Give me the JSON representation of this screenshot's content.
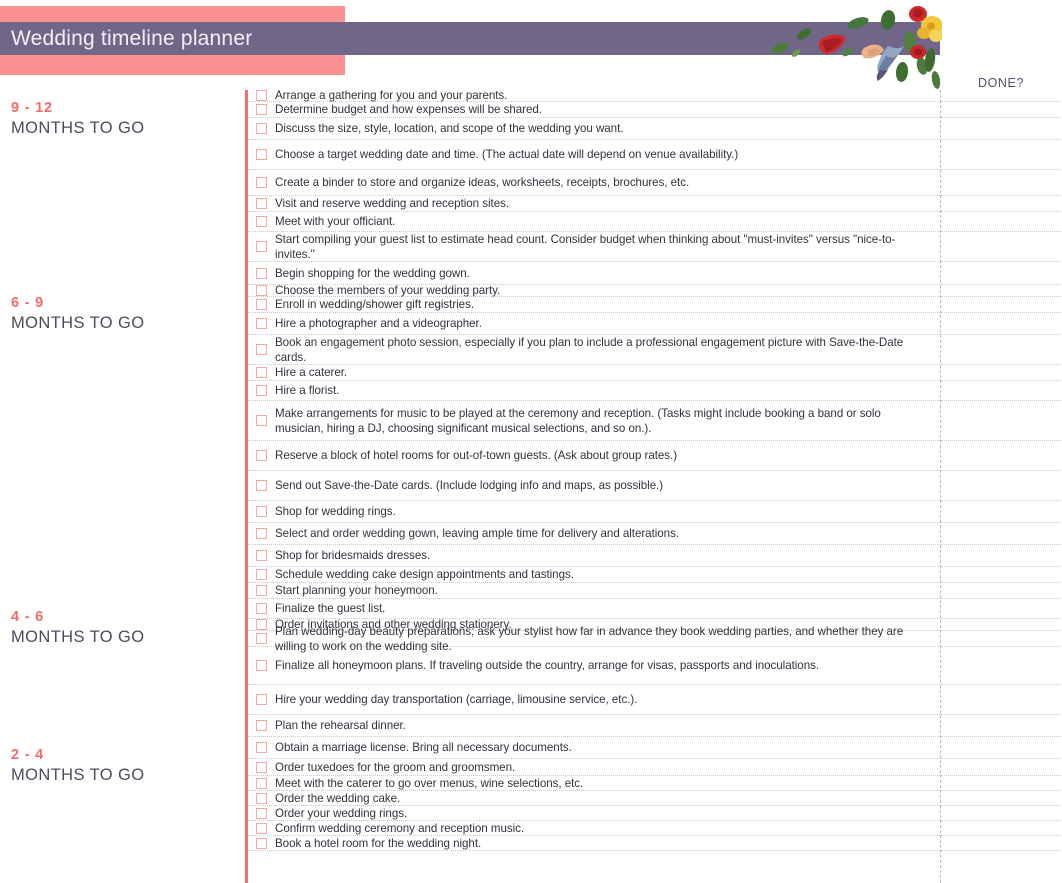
{
  "header": {
    "title": "Wedding timeline planner",
    "done_column_label": "DONE?",
    "colors": {
      "pink_band": "#fa9191",
      "purple_band": "#6f6688",
      "title_text": "#f3f1f7",
      "accent_red": "#f5706e",
      "section_range": "#f26b6b",
      "section_sub": "#4e4a5c",
      "checkbox_border": "#f8a6a6"
    },
    "decoration": "floral-petals-image"
  },
  "sections": [
    {
      "range": "9 - 12",
      "subtitle": "MONTHS TO GO",
      "tasks": [
        "Arrange a gathering for you and your parents.",
        "Determine budget and how expenses will be shared.",
        "Discuss the size, style, location, and scope of the wedding you want.",
        "Choose a target wedding date and time. (The actual date will depend on venue availability.)",
        "Create a binder to store and organize ideas, worksheets, receipts, brochures, etc.",
        "Visit and reserve wedding and reception sites.",
        "Meet with your officiant.",
        "Start compiling your guest list to estimate head count. Consider budget when thinking about \"must-invites\" versus \"nice-to-invites.\"",
        "Begin shopping for the wedding gown."
      ]
    },
    {
      "range": "6 - 9",
      "subtitle": "MONTHS TO GO",
      "tasks": [
        "Choose the members of your wedding party.",
        "Enroll in wedding/shower gift registries.",
        "Hire a photographer and a videographer.",
        "Book an engagement photo session, especially if you plan to include a professional engagement picture with Save-the-Date cards.",
        "Hire a caterer.",
        "Hire a florist.",
        "Make arrangements for music to be played at the ceremony and reception. (Tasks might include booking a band or solo musician, hiring a DJ, choosing significant musical selections, and so on.).",
        "Reserve a block of hotel rooms for out-of-town guests. (Ask about group rates.)",
        "Send out Save-the-Date cards. (Include lodging info and maps, as possible.)",
        "Shop for wedding rings.",
        "Select and order wedding gown, leaving ample time for delivery and alterations.",
        "Shop for bridesmaids dresses.",
        "Schedule wedding cake design appointments and tastings.",
        "Start planning your honeymoon."
      ]
    },
    {
      "range": "4 - 6",
      "subtitle": "MONTHS TO GO",
      "tasks": [
        "Finalize the guest list.",
        "Order invitations and other wedding stationery.",
        "Plan wedding-day beauty preparations; ask your stylist how far in advance they book wedding parties, and whether they are willing to work on the wedding site.",
        "Finalize all honeymoon plans. If traveling outside the country, arrange for visas, passports and inoculations.",
        "Hire your wedding day transportation (carriage, limousine service, etc.).",
        "Plan the rehearsal dinner."
      ]
    },
    {
      "range": "2 - 4",
      "subtitle": "MONTHS TO GO",
      "tasks": [
        "Obtain a marriage license. Bring all necessary documents.",
        "Order tuxedoes for the groom and groomsmen.",
        "Meet with the caterer to go over menus, wine selections, etc.",
        "Order the wedding cake.",
        "Order your wedding rings.",
        "Confirm wedding ceremony and reception music.",
        "Book a hotel room for the wedding night."
      ]
    }
  ],
  "row_layout": {
    "heights": [
      12,
      16,
      22,
      30,
      26,
      16,
      20,
      30,
      23,
      12,
      16,
      22,
      30,
      16,
      20,
      40,
      30,
      30,
      22,
      22,
      22,
      16,
      16,
      20,
      12,
      16,
      38,
      30,
      22,
      22,
      17,
      15,
      15,
      15,
      15,
      15,
      15
    ]
  }
}
